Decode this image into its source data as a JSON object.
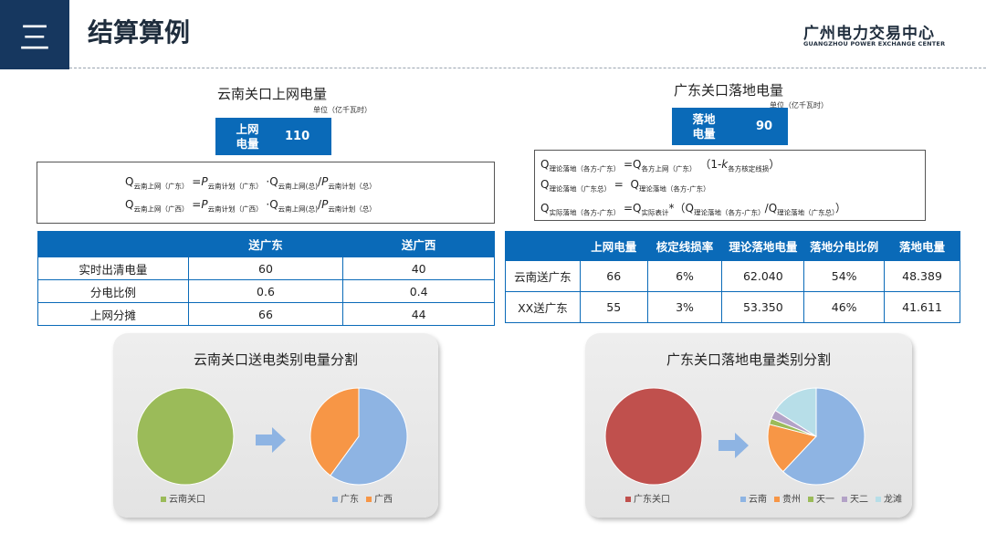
{
  "header": {
    "section_number": "三",
    "title": "结算算例",
    "brand_cn": "广州电力交易中心",
    "brand_en": "GUANGZHOU POWER EXCHANGE CENTER"
  },
  "left": {
    "title": "云南关口上网电量",
    "unit": "单位（亿千瓦时）",
    "kpi_label": "上网\n电量",
    "kpi_value": "110",
    "table_headers": [
      "",
      "送广东",
      "送广西"
    ],
    "table_rows": [
      [
        "实时出清电量",
        "60",
        "40"
      ],
      [
        "分电比例",
        "0.6",
        "0.4"
      ],
      [
        "上网分摊",
        "66",
        "44"
      ]
    ]
  },
  "right": {
    "title": "广东关口落地电量",
    "unit": "单位（亿千瓦时）",
    "kpi_label": "落地\n电量",
    "kpi_value": "90",
    "table_headers": [
      "",
      "上网电量",
      "核定线损率",
      "理论落地电量",
      "落地分电比例",
      "落地电量"
    ],
    "table_rows": [
      [
        "云南送广东",
        "66",
        "6%",
        "62.040",
        "54%",
        "48.389"
      ],
      [
        "XX送广东",
        "55",
        "3%",
        "53.350",
        "46%",
        "41.611"
      ]
    ]
  },
  "chart_data": [
    {
      "type": "pie",
      "title": "云南关口送电类别电量分割",
      "source": {
        "labels": [
          "云南关口"
        ],
        "values": [
          100
        ],
        "colors": [
          "#9bbb59"
        ]
      },
      "split": {
        "labels": [
          "广东",
          "广西"
        ],
        "values": [
          66,
          44
        ],
        "colors": [
          "#8eb4e3",
          "#f79646"
        ]
      }
    },
    {
      "type": "pie",
      "title": "广东关口落地电量类别分割",
      "source": {
        "labels": [
          "广东关口"
        ],
        "values": [
          100
        ],
        "colors": [
          "#c0504d"
        ]
      },
      "split": {
        "labels": [
          "云南",
          "贵州",
          "天一",
          "天二",
          "龙滩"
        ],
        "values": [
          62,
          17,
          2,
          3,
          16
        ],
        "colors": [
          "#8eb4e3",
          "#f79646",
          "#9bbb59",
          "#b3a2c7",
          "#b7dee8"
        ]
      }
    }
  ]
}
